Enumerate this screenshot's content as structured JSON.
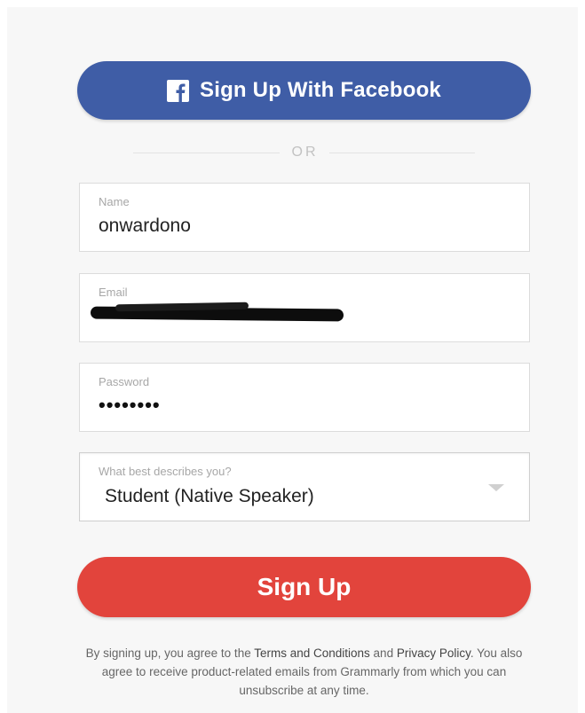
{
  "facebook_button": {
    "label": "Sign Up With Facebook",
    "icon": "facebook-icon",
    "color": "#3f5da6"
  },
  "divider": {
    "text": "OR"
  },
  "fields": {
    "name": {
      "label": "Name",
      "value": "onwardono"
    },
    "email": {
      "label": "Email"
    },
    "password": {
      "label": "Password",
      "masked_value": "••••••••"
    },
    "role": {
      "label": "What best describes you?",
      "selected": "Student (Native Speaker)",
      "icon": "chevron-down-icon"
    }
  },
  "signup_button": {
    "label": "Sign Up",
    "color": "#e2443c"
  },
  "legal": {
    "prefix": "By signing up, you agree to the ",
    "terms_link": "Terms and Conditions",
    "and": " and ",
    "privacy_link": "Privacy Policy",
    "suffix": ". You also agree to receive product-related emails from Grammarly from which you can unsubscribe at any time."
  }
}
